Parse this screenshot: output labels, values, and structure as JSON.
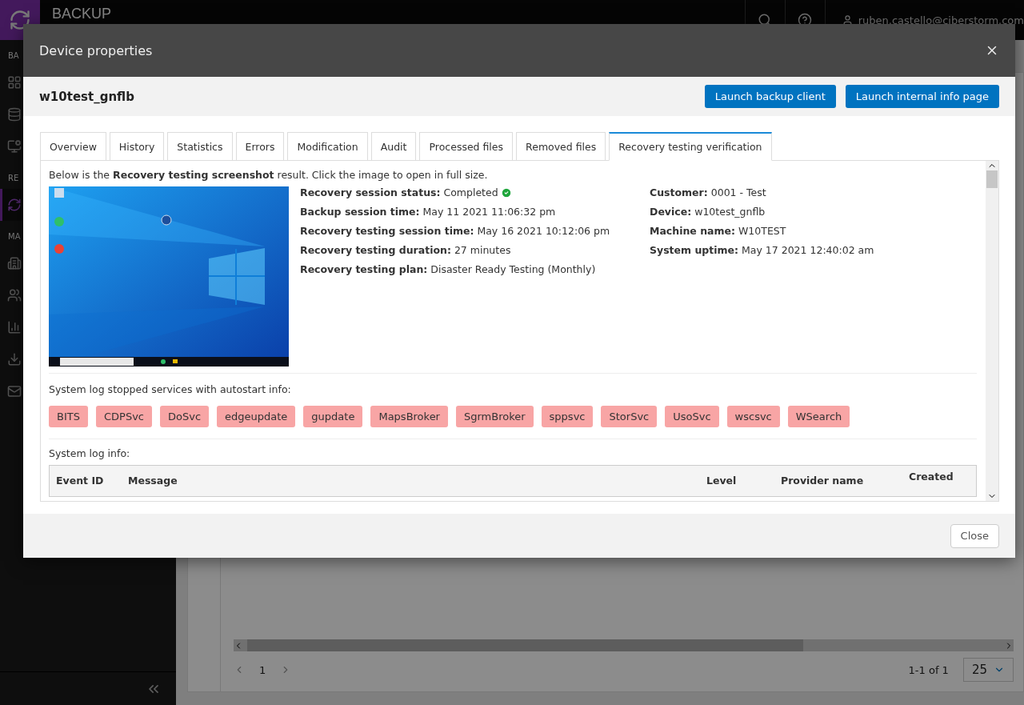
{
  "app": {
    "title": "BACKUP",
    "user": "ruben.castello@ciberstorm.com"
  },
  "sidebar": {
    "sections": [
      {
        "label": "BA",
        "items": [
          {
            "kind": "dashboard",
            "selected": false
          },
          {
            "kind": "database",
            "selected": false
          },
          {
            "kind": "monitor",
            "selected": false
          }
        ]
      },
      {
        "label": "RE",
        "items": [
          {
            "kind": "sync",
            "selected": true
          }
        ]
      },
      {
        "label": "MA",
        "items": [
          {
            "kind": "building",
            "selected": false
          },
          {
            "kind": "users",
            "selected": false
          },
          {
            "kind": "chart",
            "selected": false
          },
          {
            "kind": "download",
            "selected": false
          },
          {
            "kind": "mail",
            "selected": false
          }
        ]
      }
    ]
  },
  "background": {
    "page": "1",
    "range": "1-1 of 1",
    "page_size": "25"
  },
  "dialog": {
    "title": "Device properties",
    "device": "w10test_gnflb",
    "actions": [
      "Launch backup client",
      "Launch internal info page"
    ],
    "tabs": [
      {
        "label": "Overview",
        "selected": false
      },
      {
        "label": "History",
        "selected": false
      },
      {
        "label": "Statistics",
        "selected": false
      },
      {
        "label": "Errors",
        "selected": false
      },
      {
        "label": "Modification",
        "selected": false
      },
      {
        "label": "Audit",
        "selected": false
      },
      {
        "label": "Processed files",
        "selected": false
      },
      {
        "label": "Removed files",
        "selected": false
      },
      {
        "label": "Recovery testing verification",
        "selected": true
      }
    ],
    "intro": "Below is the **Recovery testing screenshot** result. Click the image to open in full size.",
    "screenshot": {
      "kind": "picture"
    },
    "details_left": [
      {
        "text": "**Recovery session status:** Completed",
        "verified": true
      },
      {
        "text": "**Backup session time:** May 11 2021 11:06:32 pm"
      },
      {
        "text": "**Recovery testing session time:** May 16 2021 10:12:06 pm"
      },
      {
        "text": "**Recovery testing duration:** 27 minutes"
      },
      {
        "text": "**Recovery testing plan:** Disaster Ready Testing (Monthly)"
      }
    ],
    "details_right": [
      {
        "text": "**Customer:** 0001 - Test"
      },
      {
        "text": "**Device:** w10test_gnflb"
      },
      {
        "text": "**Machine name:** W10TEST"
      },
      {
        "text": "**System uptime:** May 17 2021 12:40:02 am"
      }
    ],
    "services_label": "System log stopped services with autostart info:",
    "services": [
      "BITS",
      "CDPSvc",
      "DoSvc",
      "edgeupdate",
      "gupdate",
      "MapsBroker",
      "SgrmBroker",
      "sppsvc",
      "StorSvc",
      "UsoSvc",
      "wscsvc",
      "WSearch"
    ],
    "log_label": "System log info:",
    "log_columns": [
      "Event ID",
      "Message",
      "Level",
      "Provider name",
      "Created"
    ],
    "close": "Close"
  }
}
